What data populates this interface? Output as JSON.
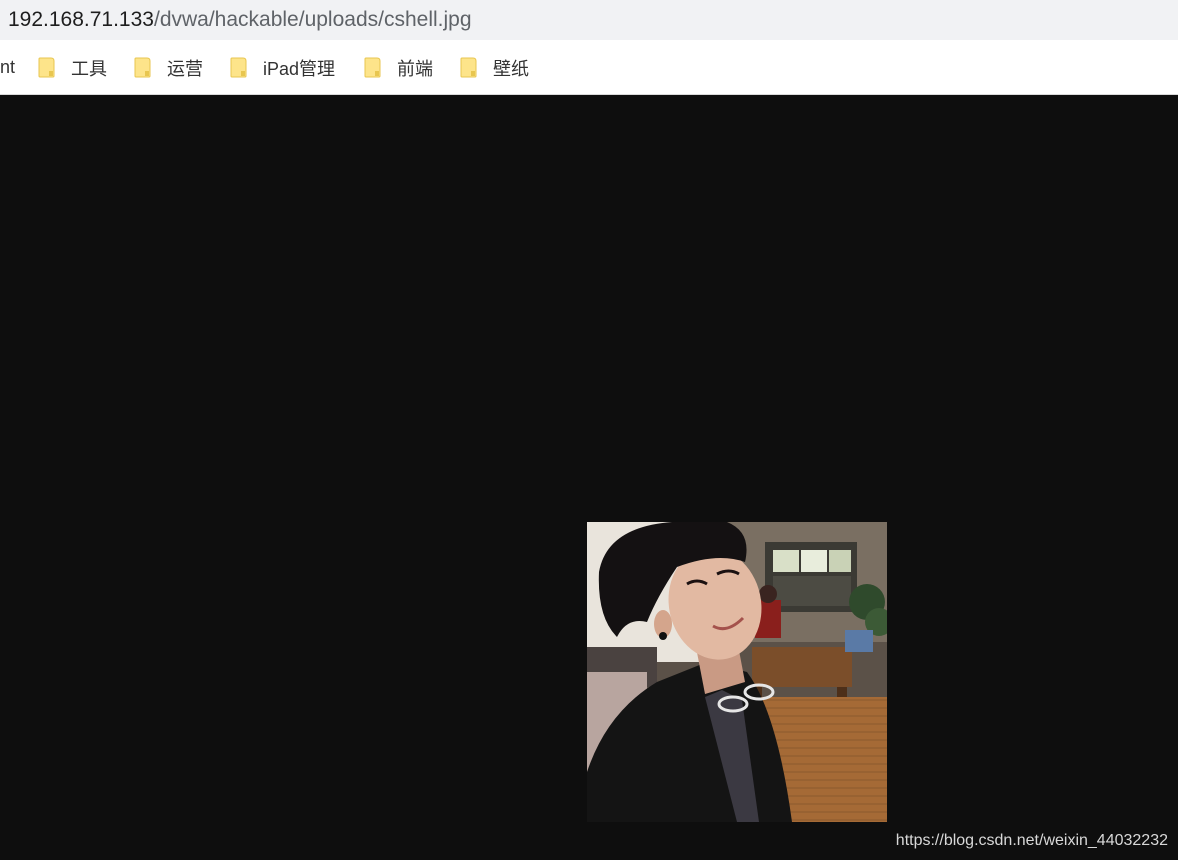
{
  "browser": {
    "url_host": "192.168.71.133",
    "url_path": "/dvwa/hackable/uploads/cshell.jpg"
  },
  "bookmarks": [
    {
      "label": "nt",
      "icon": "folder-icon",
      "partial": true
    },
    {
      "label": "工具",
      "icon": "folder-icon"
    },
    {
      "label": "运营",
      "icon": "folder-icon"
    },
    {
      "label": "iPad管理",
      "icon": "folder-icon"
    },
    {
      "label": "前端",
      "icon": "folder-icon"
    },
    {
      "label": "壁纸",
      "icon": "folder-icon"
    }
  ],
  "image_viewer": {
    "background_color": "#0e0e0e",
    "image": "selfie-photo"
  },
  "watermark": {
    "text": "https://blog.csdn.net/weixin_44032232"
  },
  "colors": {
    "folder": "#fde48a",
    "folder_edge": "#e8c650"
  }
}
